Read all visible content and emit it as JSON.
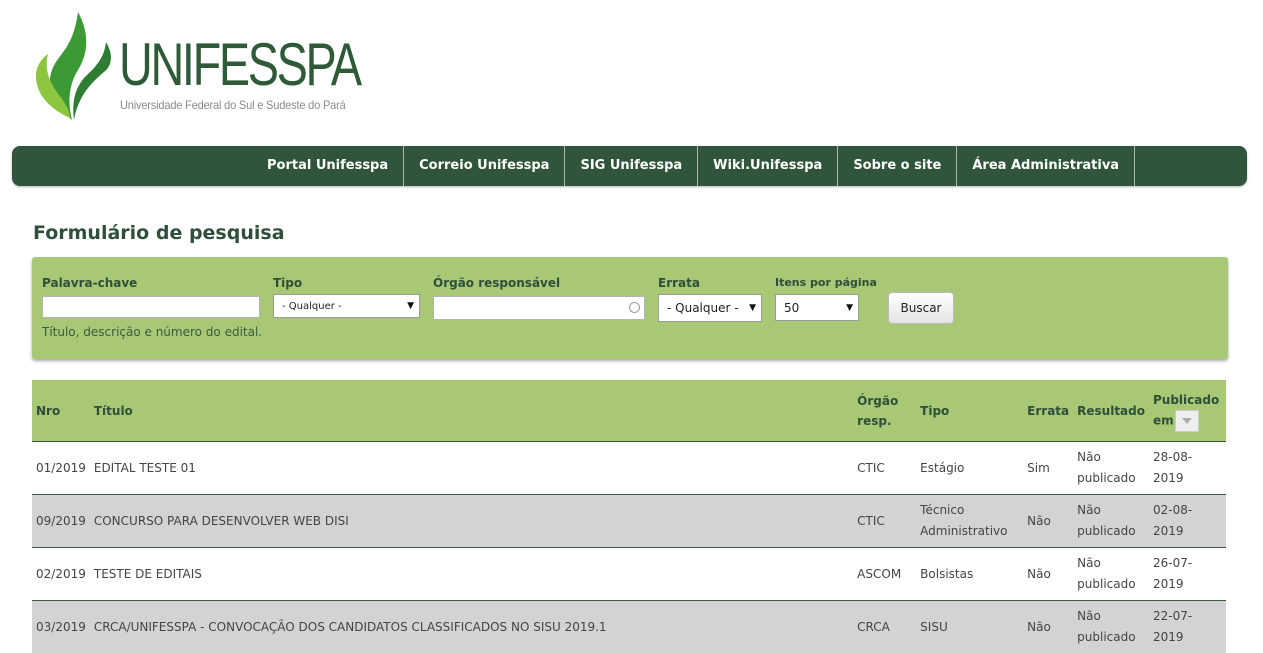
{
  "brand": {
    "name": "UNIFESSPA",
    "subtitle": "Universidade Federal do Sul e Sudeste do Pará",
    "colors": {
      "dark_green": "#30553a",
      "light_green": "#a8c875",
      "leaf_green": "#7cc142"
    }
  },
  "nav": {
    "items": [
      {
        "label": "Portal Unifesspa"
      },
      {
        "label": "Correio Unifesspa"
      },
      {
        "label": "SIG Unifesspa"
      },
      {
        "label": "Wiki.Unifesspa"
      },
      {
        "label": "Sobre o site"
      },
      {
        "label": "Área Administrativa"
      }
    ]
  },
  "page": {
    "title": "Formulário de pesquisa"
  },
  "search": {
    "keyword_label": "Palavra-chave",
    "keyword_value": "",
    "keyword_hint": "Título, descrição e número do edital.",
    "tipo_label": "Tipo",
    "tipo_value": "- Qualquer -",
    "orgao_label": "Órgão responsável",
    "orgao_value": "",
    "errata_label": "Errata",
    "errata_value": "- Qualquer -",
    "itens_label": "Itens por página",
    "itens_value": "50",
    "button_label": "Buscar"
  },
  "table": {
    "headers": {
      "nro": "Nro",
      "titulo": "Título",
      "orgao_line1": "Órgão",
      "orgao_line2": "resp.",
      "tipo": "Tipo",
      "errata": "Errata",
      "resultado": "Resultado",
      "publicado_line1": "Publicado",
      "publicado_line2": "em"
    },
    "rows": [
      {
        "nro": "01/2019",
        "titulo": "EDITAL TESTE 01",
        "orgao": "CTIC",
        "tipo": "Estágio",
        "errata": "Sim",
        "resultado": "Não publicado",
        "publicado": "28-08-2019"
      },
      {
        "nro": "09/2019",
        "titulo": "CONCURSO PARA DESENVOLVER WEB DISI",
        "orgao": "CTIC",
        "tipo": "Técnico Administrativo",
        "errata": "Não",
        "resultado": "Não publicado",
        "publicado": "02-08-2019"
      },
      {
        "nro": "02/2019",
        "titulo": "TESTE DE EDITAIS",
        "orgao": "ASCOM",
        "tipo": "Bolsistas",
        "errata": "Não",
        "resultado": "Não publicado",
        "publicado": "26-07-2019"
      },
      {
        "nro": "03/2019",
        "titulo": "CRCA/UNIFESSPA - CONVOCAÇÃO DOS CANDIDATOS CLASSIFICADOS NO SISU 2019.1",
        "orgao": "CRCA",
        "tipo": "SISU",
        "errata": "Não",
        "resultado": "Não publicado",
        "publicado": "22-07-2019"
      }
    ]
  }
}
